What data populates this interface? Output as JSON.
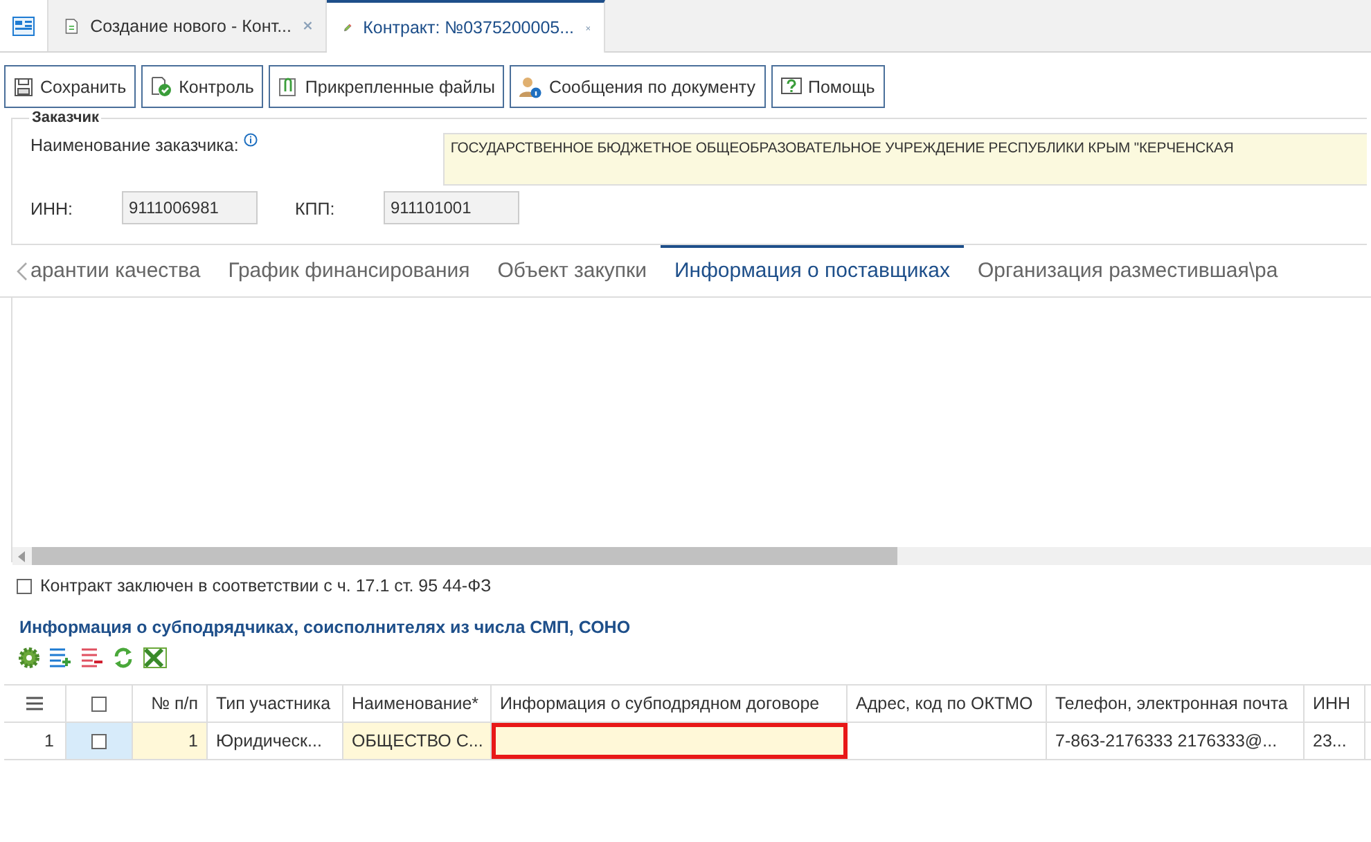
{
  "doc_tabs": [
    {
      "label": "Создание нового - Конт...",
      "selected": false,
      "kind": "new"
    },
    {
      "label": "Контракт: №0375200005...",
      "selected": true,
      "kind": "edit"
    }
  ],
  "toolbar": [
    {
      "label": "Сохранить",
      "kind": "save"
    },
    {
      "label": "Контроль",
      "kind": "check"
    },
    {
      "label": "Прикрепленные файлы",
      "kind": "attach"
    },
    {
      "label": "Сообщения по документу",
      "kind": "messages"
    },
    {
      "label": "Помощь",
      "kind": "help"
    }
  ],
  "customer": {
    "legend": "Заказчик",
    "name_label": "Наименование заказчика:",
    "name_value": "ГОСУДАРСТВЕННОЕ БЮДЖЕТНОЕ ОБЩЕОБРАЗОВАТЕЛЬНОЕ УЧРЕЖДЕНИЕ РЕСПУБЛИКИ КРЫМ \"КЕРЧЕНСКАЯ",
    "inn_label": "ИНН:",
    "inn_value": "9111006981",
    "kpp_label": "КПП:",
    "kpp_value": "911101001"
  },
  "section_tabs": [
    {
      "label": "арантии качества",
      "selected": false
    },
    {
      "label": "График финансирования",
      "selected": false
    },
    {
      "label": "Объект закупки",
      "selected": false
    },
    {
      "label": "Информация о поставщиках",
      "selected": true
    },
    {
      "label": "Организация разместившая\\ра",
      "selected": false
    }
  ],
  "contract_checkbox": {
    "label": "Контракт заключен в соответствии с ч. 17.1 ст. 95 44-ФЗ",
    "checked": false
  },
  "subcontractors": {
    "title": "Информация о субподрядчиках, соисполнителях из числа СМП, СОНО",
    "select_all_checked": false,
    "columns": [
      "№ п/п",
      "Тип участника",
      "Наименование*",
      "Информация о субподрядном договоре",
      "Адрес, код по ОКТМО",
      "Телефон, электронная почта",
      "ИНН"
    ],
    "rows": [
      {
        "row_number": "1",
        "checked": false,
        "cells": [
          "1",
          "Юридическ...",
          "ОБЩЕСТВО С...",
          "",
          "",
          "7-863-2176333 2176333@...",
          "23..."
        ]
      }
    ]
  }
}
